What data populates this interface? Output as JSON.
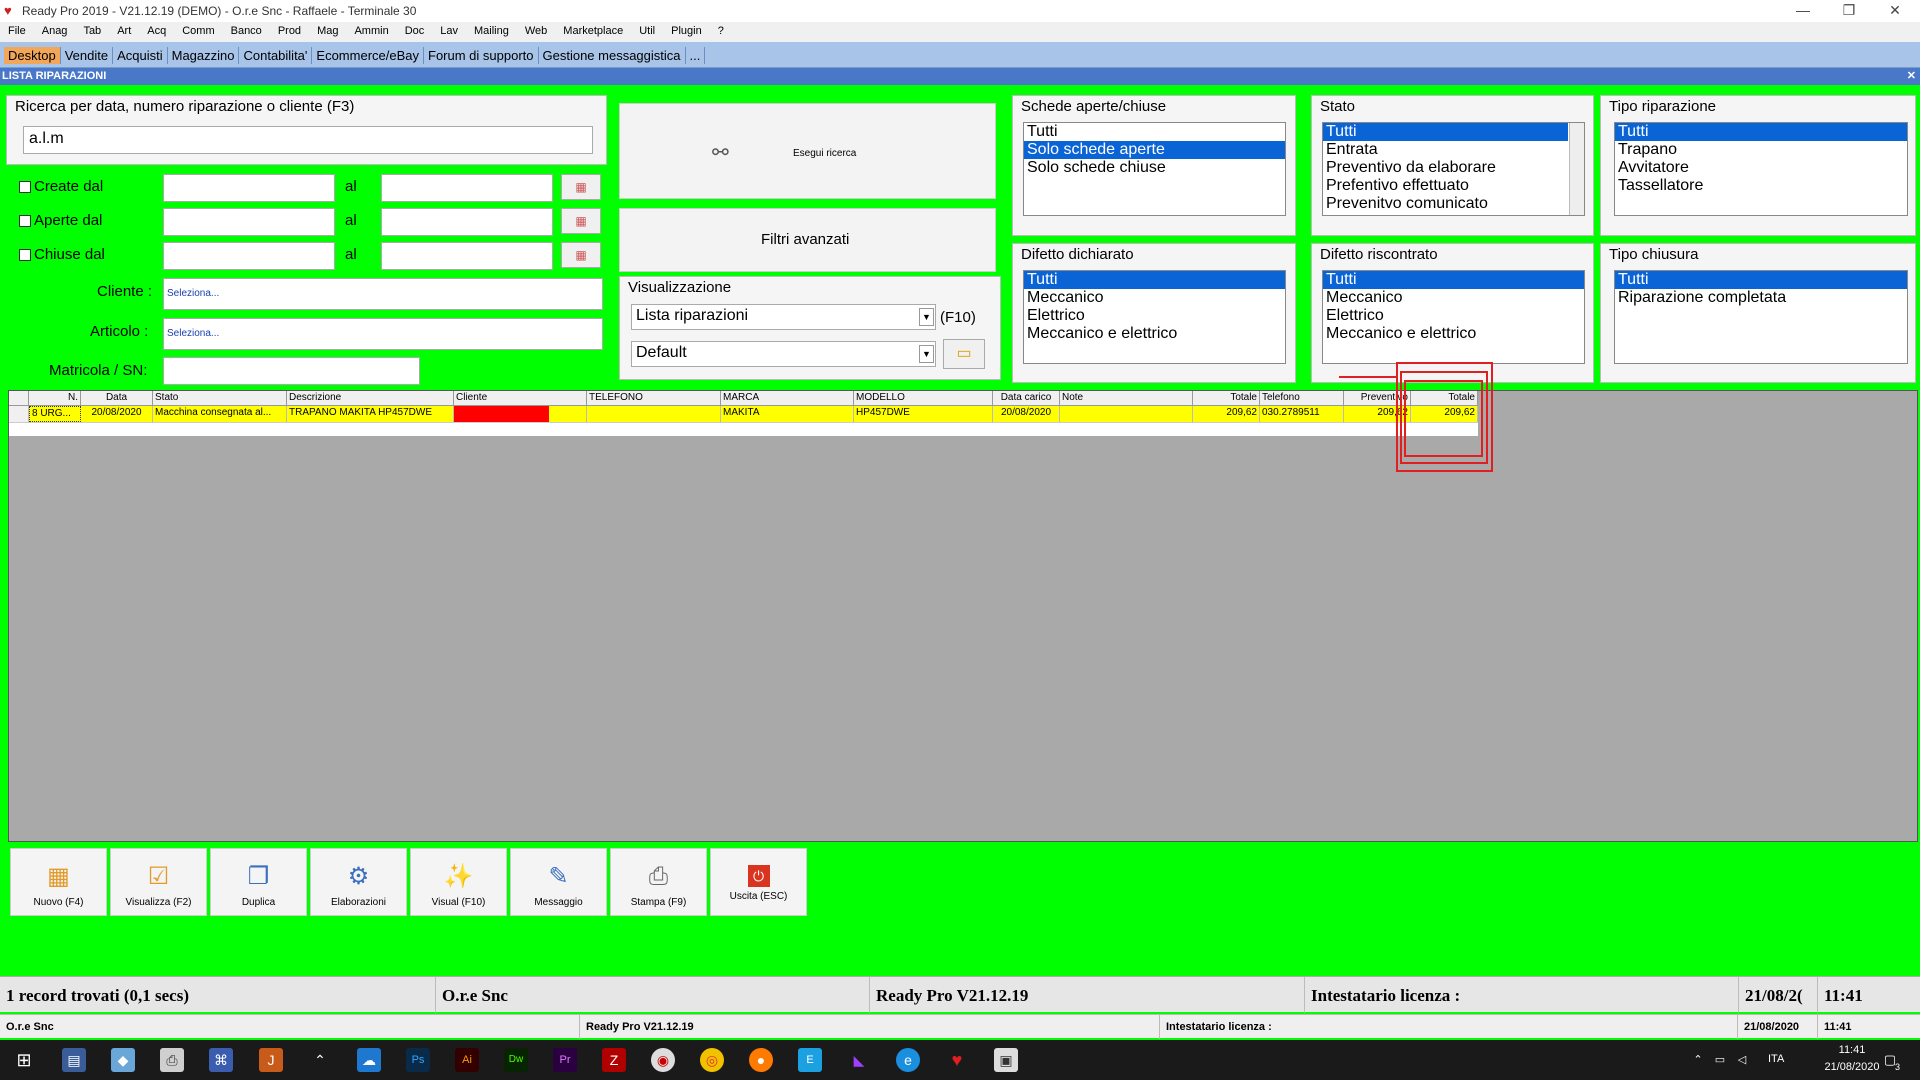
{
  "window": {
    "title": "Ready Pro 2019 - V21.12.19 (DEMO) - O.r.e Snc - Raffaele - Terminale 30",
    "minimize": "—",
    "restore": "❐",
    "close": "✕"
  },
  "menu": [
    "File",
    "Anag",
    "Tab",
    "Art",
    "Acq",
    "Comm",
    "Banco",
    "Prod",
    "Mag",
    "Ammin",
    "Doc",
    "Lav",
    "Mailing",
    "Web",
    "Marketplace",
    "Util",
    "Plugin",
    "?"
  ],
  "tabs": [
    "Desktop",
    "Vendite",
    "Acquisti",
    "Magazzino",
    "Contabilita'",
    "Ecommerce/eBay",
    "Forum di supporto",
    "Gestione messaggistica",
    "..."
  ],
  "section": {
    "title": "LISTA RIPARAZIONI",
    "close": "✕"
  },
  "search": {
    "label": "Ricerca per data, numero riparazione o cliente (F3)",
    "value": "a.l.m"
  },
  "dates": {
    "created": "Create dal",
    "opened": "Aperte dal",
    "closed": "Chiuse dal",
    "al": "al",
    "cal_icon": "calendar-icon"
  },
  "fields": {
    "cliente_label": "Cliente :",
    "cliente_value": "Seleziona...",
    "articolo_label": "Articolo :",
    "articolo_value": "Seleziona...",
    "matricola_label": "Matricola / SN:"
  },
  "actions": {
    "search_button": "Esegui ricerca",
    "advanced_filters": "Filtri avanzati"
  },
  "view": {
    "label": "Visualizzazione",
    "list_value": "Lista riparazioni",
    "f10": "(F10)",
    "layout_value": "Default"
  },
  "schede": {
    "label": "Schede aperte/chiuse",
    "items": [
      "Tutti",
      "Solo schede aperte",
      "Solo schede chiuse"
    ],
    "selected": 1
  },
  "stato": {
    "label": "Stato",
    "items": [
      "Tutti",
      "Entrata",
      "Preventivo da elaborare",
      "Prefentivo effettuato",
      "Prevenitvo comunicato"
    ],
    "selected": 0
  },
  "tipo_rip": {
    "label": "Tipo riparazione",
    "items": [
      "Tutti",
      "Trapano",
      "Avvitatore",
      "Tassellatore"
    ],
    "selected": 0
  },
  "difetto_dich": {
    "label": "Difetto dichiarato",
    "items": [
      "Tutti",
      "Meccanico",
      "Elettrico",
      "Meccanico e elettrico"
    ],
    "selected": 0
  },
  "difetto_risc": {
    "label": "Difetto riscontrato",
    "items": [
      "Tutti",
      "Meccanico",
      "Elettrico",
      "Meccanico e elettrico"
    ],
    "selected": 0
  },
  "tipo_chiusura": {
    "label": "Tipo chiusura",
    "items": [
      "Tutti",
      "Riparazione completata"
    ],
    "selected": 0
  },
  "grid": {
    "headers": [
      "N.",
      "Data",
      "Stato",
      "Descrizione",
      "Cliente",
      "TELEFONO",
      "MARCA",
      "MODELLO",
      "Data carico",
      "Note",
      "Totale",
      "Telefono",
      "Preventivo",
      "Totale"
    ],
    "row": [
      "8 URG...",
      "20/08/2020",
      "Macchina consegnata al...",
      "TRAPANO MAKITA HP457DWE",
      "",
      "",
      "MAKITA",
      "HP457DWE",
      "20/08/2020",
      "",
      "209,62",
      "030.2789511",
      "209,62",
      "209,62"
    ]
  },
  "toolbar": [
    "Nuovo (F4)",
    "Visualizza (F2)",
    "Duplica",
    "Elaborazioni",
    "Visual (F10)",
    "Messaggio",
    "Stampa (F9)",
    "Uscita (ESC)"
  ],
  "status": {
    "records": "1 record trovati (0,1 secs)",
    "company": "O.r.e Snc",
    "version": "Ready Pro V21.12.19",
    "license": "Intestatario licenza :",
    "date": "21/08/2(",
    "time": "11:41"
  },
  "status2": {
    "company": "O.r.e Snc",
    "version": "Ready Pro V21.12.19",
    "license": "Intestatario licenza :",
    "date": "21/08/2020",
    "time": "11:41"
  },
  "taskbar": {
    "lang": "ITA",
    "time": "11:41",
    "date": "21/08/2020",
    "notif": "3"
  }
}
